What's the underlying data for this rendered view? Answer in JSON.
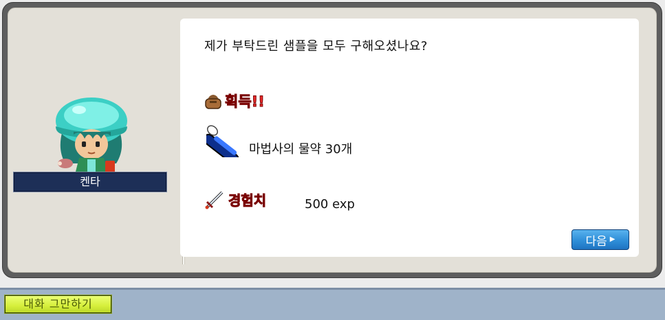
{
  "npc": {
    "name": "켄타"
  },
  "dialog": {
    "question": "제가 부탁드린 샘플을 모두 구해오셨나요?",
    "obtain_label": "획득!!",
    "reward_item": "마법사의 물약 30개",
    "exp_label": "경험치",
    "exp_value": "500 exp"
  },
  "buttons": {
    "next_label": "다음",
    "end_chat_label": "대화 그만하기"
  },
  "icons": {
    "bag": "bag-icon",
    "potion": "potion-icon",
    "sword": "sword-icon",
    "arrow": "arrow-right-icon"
  },
  "colors": {
    "highlight_red": "#ea2b2b",
    "nameplate_navy": "#1d2f57",
    "next_button_blue": "#2f8ed8",
    "end_chat_green": "#d6ef3c"
  }
}
